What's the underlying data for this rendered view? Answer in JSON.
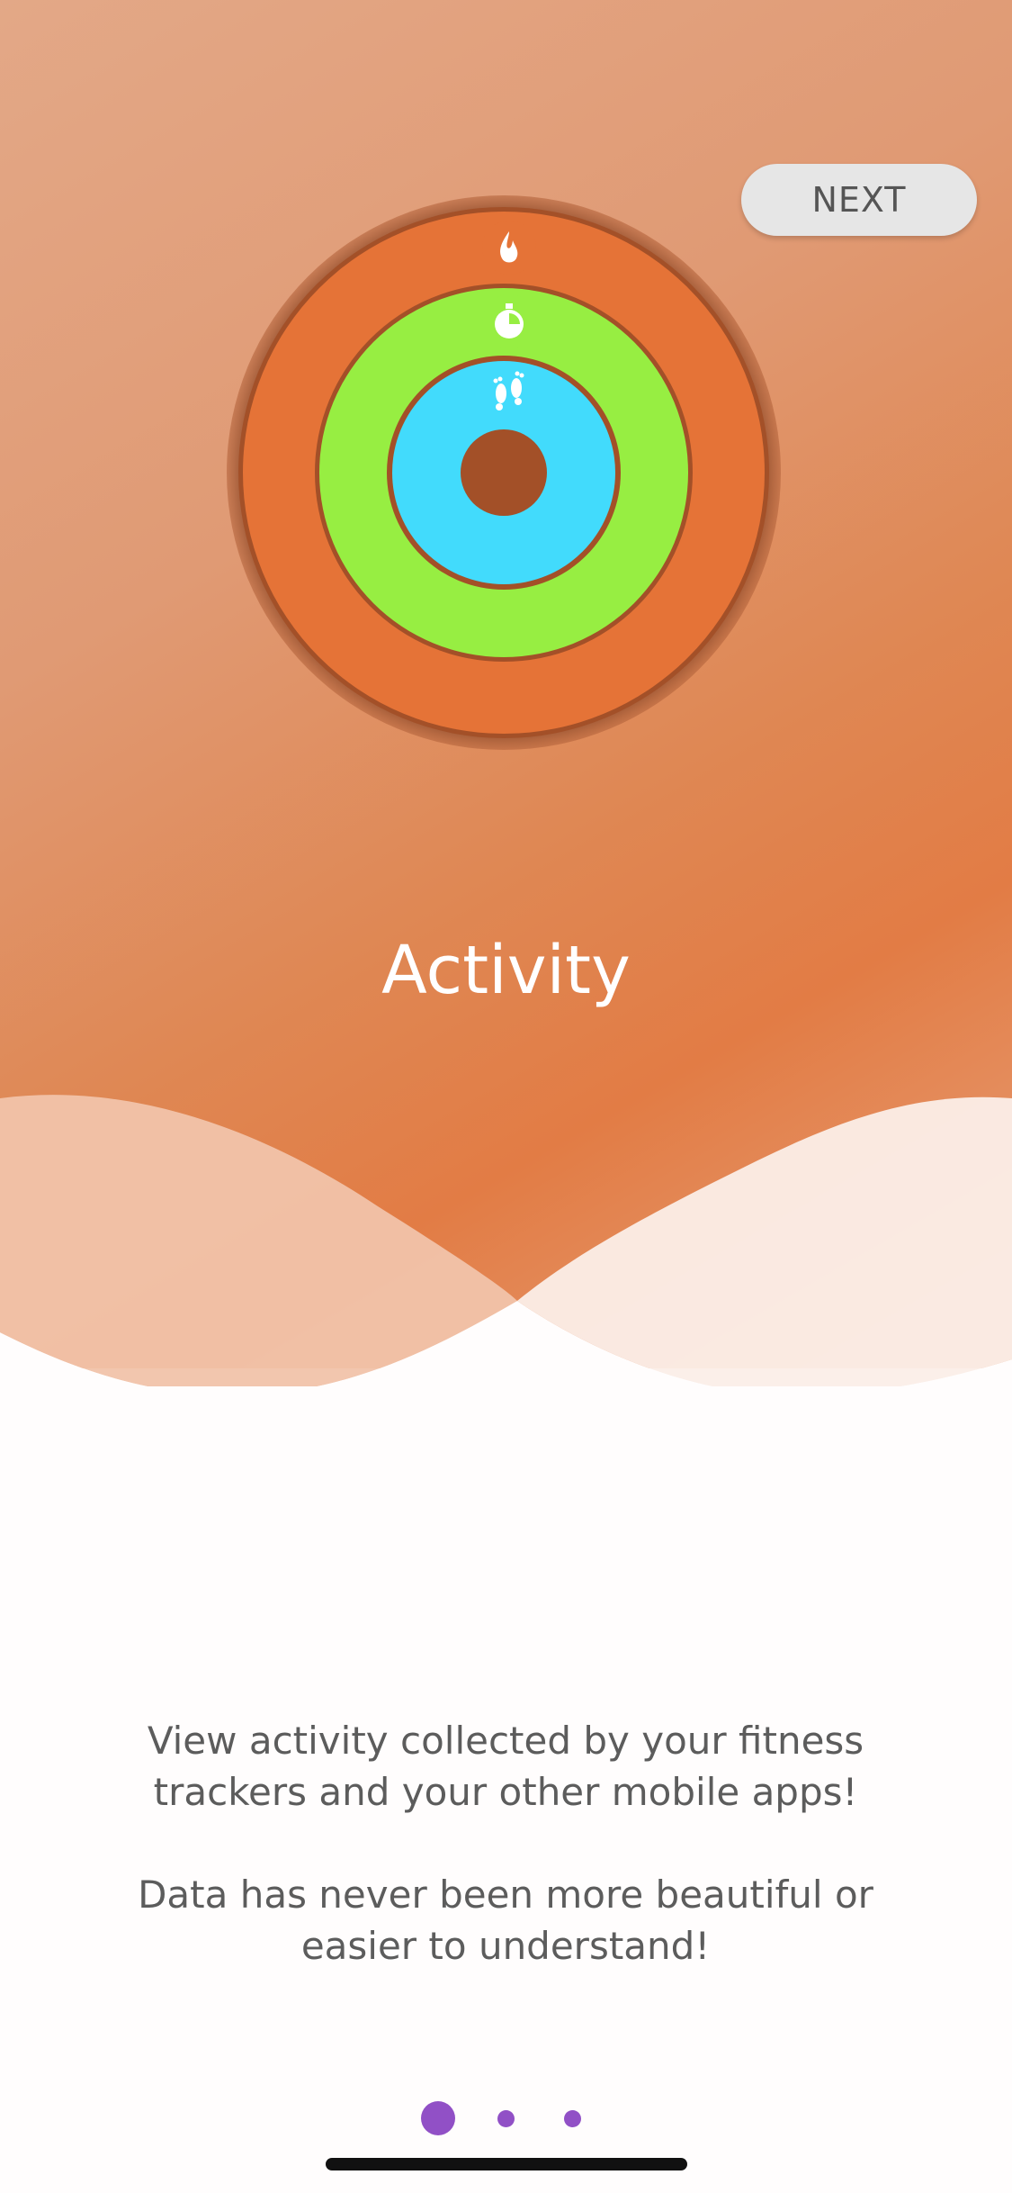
{
  "header": {
    "next_label": "NEXT"
  },
  "hero": {
    "title": "Activity",
    "rings": [
      {
        "name": "move",
        "color": "#e57337",
        "icon": "flame-icon"
      },
      {
        "name": "exercise",
        "color": "#97ee42",
        "icon": "stopwatch-icon"
      },
      {
        "name": "steps",
        "color": "#42dbfc",
        "icon": "footsteps-icon"
      }
    ],
    "ring_divider_color": "#a35028"
  },
  "body": {
    "description_1": "View activity collected by your fitness trackers and your other mobile apps!",
    "description_2": "Data has never been more beautiful or easier to understand!"
  },
  "pager": {
    "page_count": 3,
    "active_index": 0,
    "dot_color": "#9150c6"
  }
}
